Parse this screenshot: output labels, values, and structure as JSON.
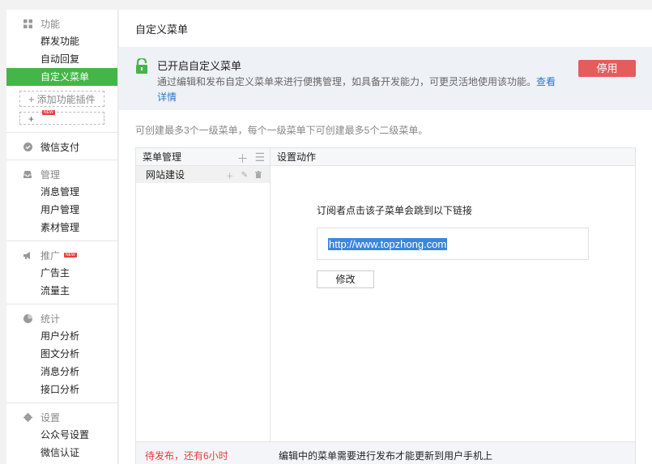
{
  "sidebar": {
    "function_section": {
      "title": "功能",
      "items": [
        {
          "label": "群发功能",
          "active": false
        },
        {
          "label": "自动回复",
          "active": false
        },
        {
          "label": "自定义菜单",
          "active": true
        }
      ],
      "add_plugin_label": "添加功能插件",
      "new_tag": "NEW"
    },
    "pay_section": {
      "title": "微信支付"
    },
    "manage_section": {
      "title": "管理",
      "items": [
        {
          "label": "消息管理"
        },
        {
          "label": "用户管理"
        },
        {
          "label": "素材管理"
        }
      ]
    },
    "promote_section": {
      "title": "推广",
      "new_tag": "NEW",
      "items": [
        {
          "label": "广告主"
        },
        {
          "label": "流量主"
        }
      ]
    },
    "stats_section": {
      "title": "统计",
      "items": [
        {
          "label": "用户分析"
        },
        {
          "label": "图文分析"
        },
        {
          "label": "消息分析"
        },
        {
          "label": "接口分析"
        }
      ]
    },
    "settings_section": {
      "title": "设置",
      "items": [
        {
          "label": "公众号设置"
        },
        {
          "label": "微信认证"
        }
      ]
    }
  },
  "main": {
    "page_title": "自定义菜单",
    "notice": {
      "title": "已开启自定义菜单",
      "description": "通过编辑和发布自定义菜单来进行便携管理，如具备开发能力，可更灵活地使用该功能。",
      "link_text_part1": "查看",
      "link_text_part2": "详情",
      "disable_button": "停用"
    },
    "tip": "可创建最多3个一级菜单，每个一级菜单下可创建最多5个二级菜单。",
    "menu_panel": {
      "menu_header": "菜单管理",
      "menus": [
        {
          "label": "网站建设"
        }
      ],
      "action_header": "设置动作",
      "redirect_label": "订阅者点击该子菜单会跳到以下链接",
      "url": "http://www.topzhong.com",
      "edit_button": "修改",
      "footer_status": "待发布，还有6小时",
      "footer_note": "编辑中的菜单需要进行发布才能更新到用户手机上"
    }
  },
  "icons": {
    "function": "grid-icon",
    "pay": "check-circle-icon",
    "manage": "inbox-icon",
    "promote": "megaphone-icon",
    "stats": "pie-icon",
    "settings": "gear-icon",
    "notice": "unlocked-lock-icon"
  },
  "colors": {
    "active_green": "#44b549",
    "danger_red": "#e55c5c",
    "link_blue": "#2d78ca"
  }
}
